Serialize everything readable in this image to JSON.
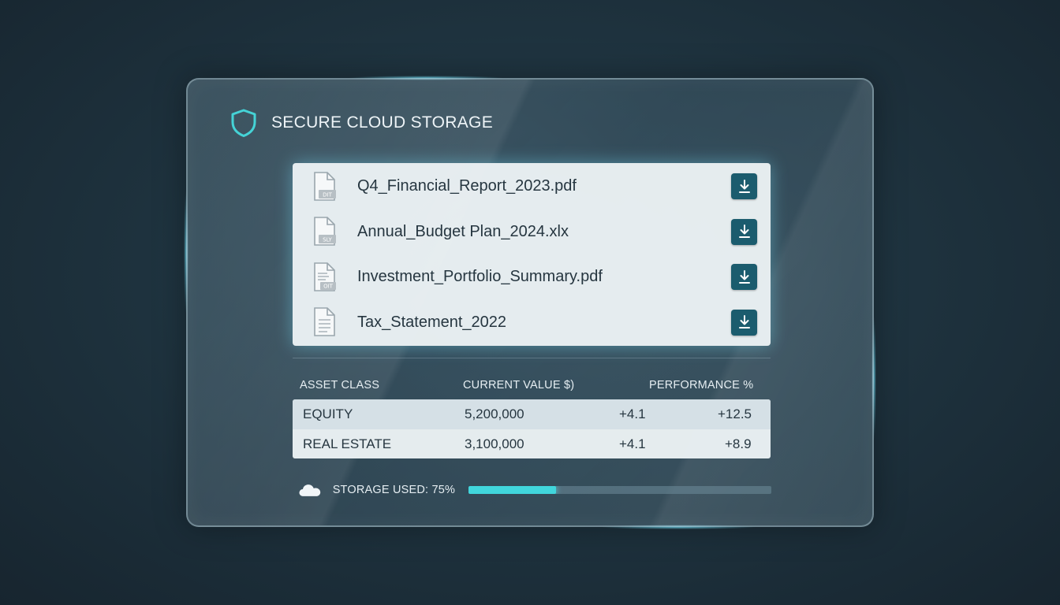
{
  "header": {
    "title": "SECURE CLOUD STORAGE",
    "icon": "shield-icon",
    "accent": "#45d3d6"
  },
  "files": [
    {
      "name": "Q4_Financial_Report_2023.pdf",
      "badge": "DIT",
      "icon": "file-icon"
    },
    {
      "name": "Annual_Budget Plan_2024.xlx",
      "badge": "SLY",
      "icon": "file-icon"
    },
    {
      "name": "Investment_Portfolio_Summary.pdf",
      "badge": "OIT",
      "icon": "file-icon"
    },
    {
      "name": "Tax_Statement_2022",
      "badge": "",
      "icon": "file-icon"
    }
  ],
  "table": {
    "headers": [
      "ASSET CLASS",
      "CURRENT VALUE $)",
      "PERFORMANCE %"
    ],
    "rows": [
      {
        "asset": "EQUITY",
        "value": "5,200,000",
        "perf_a": "+4.1",
        "perf_b": "+12.5"
      },
      {
        "asset": "REAL ESTATE",
        "value": "3,100,000",
        "perf_a": "+4.1",
        "perf_b": "+8.9"
      }
    ]
  },
  "storage": {
    "label": "STORAGE USED: 75%",
    "used_fraction": 0.29,
    "bar_color": "#41d6dc"
  },
  "colors": {
    "download_button": "#1b5c6e",
    "text_dark": "#263640"
  }
}
